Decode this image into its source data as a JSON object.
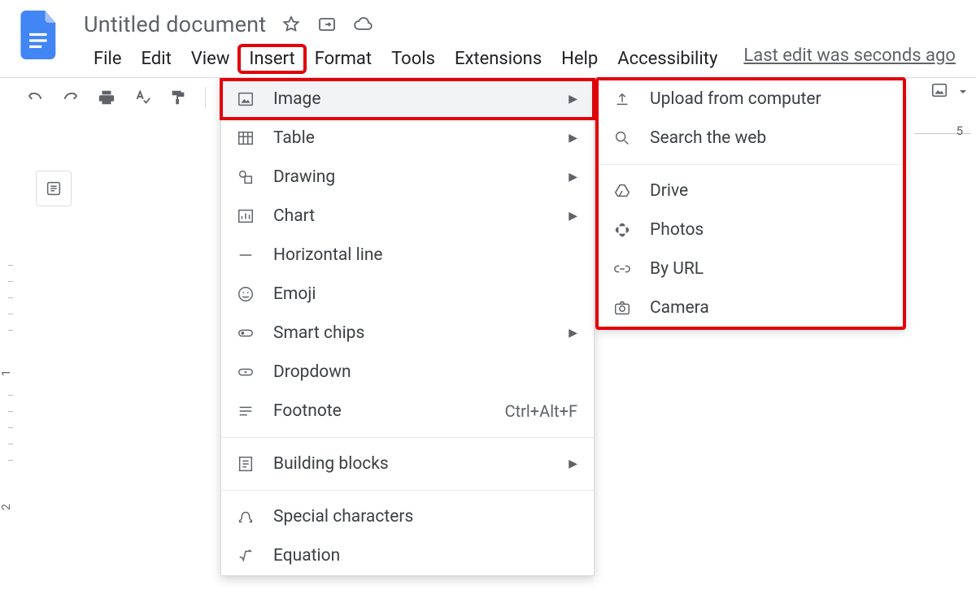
{
  "doc": {
    "title": "Untitled document",
    "edit_info": "Last edit was seconds ago"
  },
  "menubar": {
    "file": "File",
    "edit": "Edit",
    "view": "View",
    "insert": "Insert",
    "format": "Format",
    "tools": "Tools",
    "extensions": "Extensions",
    "help": "Help",
    "accessibility": "Accessibility"
  },
  "insert_menu": {
    "image": {
      "label": "Image"
    },
    "table": {
      "label": "Table"
    },
    "drawing": {
      "label": "Drawing"
    },
    "chart": {
      "label": "Chart"
    },
    "hr": {
      "label": "Horizontal line"
    },
    "emoji": {
      "label": "Emoji"
    },
    "smart_chips": {
      "label": "Smart chips"
    },
    "dropdown": {
      "label": "Dropdown"
    },
    "footnote": {
      "label": "Footnote",
      "shortcut": "Ctrl+Alt+F"
    },
    "building_blocks": {
      "label": "Building blocks"
    },
    "special_chars": {
      "label": "Special characters"
    },
    "equation": {
      "label": "Equation"
    }
  },
  "image_submenu": {
    "upload": {
      "label": "Upload from computer"
    },
    "search": {
      "label": "Search the web"
    },
    "drive": {
      "label": "Drive"
    },
    "photos": {
      "label": "Photos"
    },
    "by_url": {
      "label": "By URL"
    },
    "camera": {
      "label": "Camera"
    }
  },
  "ruler": {
    "five": "5"
  },
  "vruler": {
    "one": "1",
    "two": "2"
  }
}
